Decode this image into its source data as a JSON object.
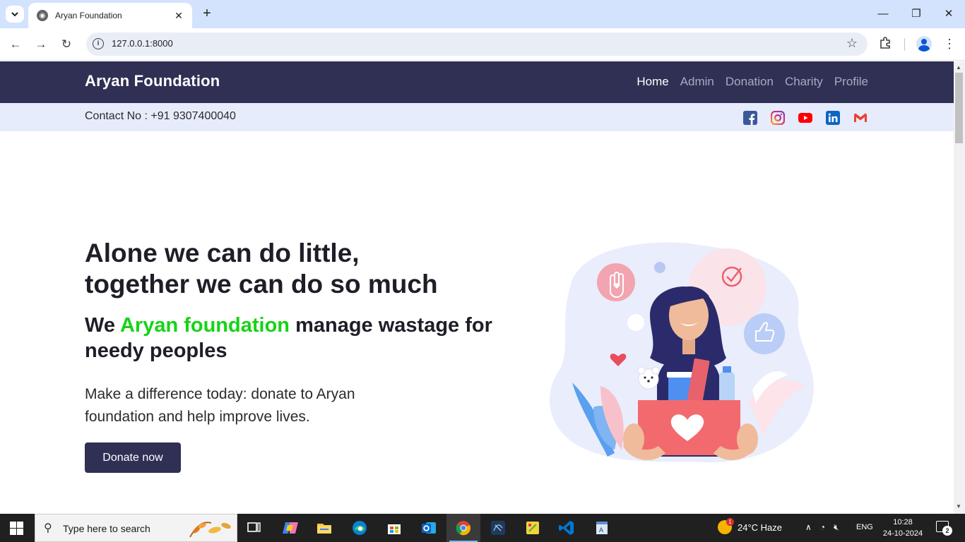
{
  "browser": {
    "tab_title": "Aryan Foundation",
    "url": "127.0.0.1:8000"
  },
  "site": {
    "brand": "Aryan Foundation",
    "nav": [
      {
        "label": "Home",
        "active": true
      },
      {
        "label": "Admin",
        "active": false
      },
      {
        "label": "Donation",
        "active": false
      },
      {
        "label": "Charity",
        "active": false
      },
      {
        "label": "Profile",
        "active": false
      }
    ],
    "contact": "Contact No : +91 9307400040",
    "social": [
      "facebook-icon",
      "instagram-icon",
      "youtube-icon",
      "linkedin-icon",
      "gmail-icon"
    ]
  },
  "hero": {
    "title_line1": "Alone we can do little,",
    "title_line2": "together we can do so much",
    "subtitle_pre": "We ",
    "subtitle_highlight": "Aryan foundation",
    "subtitle_post": " manage wastage for needy peoples",
    "lead": "Make a difference today: donate to Aryan foundation and help improve lives.",
    "cta": "Donate now",
    "highlight_color": "#16d316",
    "navbar_color": "#2f3054"
  },
  "taskbar": {
    "search_placeholder": "Type here to search",
    "weather": "24°C  Haze",
    "weather_badge": "1",
    "language": "ENG",
    "time": "10:28",
    "date": "24-10-2024",
    "notifications": "2"
  }
}
